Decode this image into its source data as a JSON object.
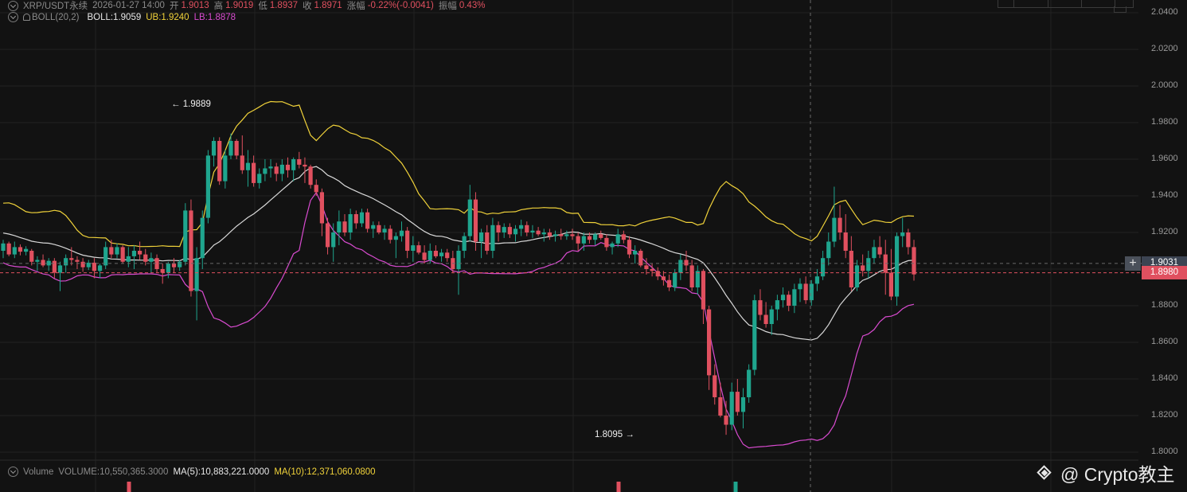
{
  "header": {
    "symbol": "XRP/USDT永续",
    "datetime": "2026-01-27 14:00",
    "open_label": "开",
    "open": "1.9013",
    "high_label": "高",
    "high": "1.9019",
    "low_label": "低",
    "low": "1.8937",
    "close_label": "收",
    "close": "1.8971",
    "change_label": "涨幅",
    "change": "-0.22%(-0.0041)",
    "amp_label": "振幅",
    "amp": "0.43%"
  },
  "boll": {
    "name": "BOLL(20,2)",
    "mid": "BOLL:1.9059",
    "ub": "UB:1.9240",
    "lb": "LB:1.8878"
  },
  "volume": {
    "name": "Volume",
    "value": "VOLUME:10,550,365.3000",
    "ma5": "MA(5):10,883,221.0000",
    "ma10": "MA(10):12,371,060.0800"
  },
  "price_boxes": {
    "crosshair": "1.9031",
    "last": "1.8980"
  },
  "annotations": {
    "high": "← 1.9889",
    "low": "1.8095 →"
  },
  "watermark": "@ Crypto教主",
  "colors": {
    "up": "#1fa58e",
    "down": "#e0505f",
    "ub": "#f0d23a",
    "mid": "#d8d8d8",
    "lb": "#d94bd0",
    "background": "#121212",
    "grid": "#222222"
  },
  "chart_data": {
    "type": "candlestick",
    "y_axis": {
      "ticks": [
        "2.0400",
        "2.0200",
        "2.0000",
        "1.9800",
        "1.9600",
        "1.9400",
        "1.9200",
        "1.9000",
        "1.8800",
        "1.8600",
        "1.8400",
        "1.8200",
        "1.8000"
      ],
      "range": [
        1.7925,
        2.042
      ]
    },
    "bars_total": 161,
    "candles": [
      [
        1.91,
        1.916,
        1.906,
        1.914
      ],
      [
        1.914,
        1.915,
        1.907,
        1.908
      ],
      [
        1.908,
        1.915,
        1.906,
        1.912
      ],
      [
        1.912,
        1.9135,
        1.9075,
        1.9095
      ],
      [
        1.9095,
        1.9125,
        1.9075,
        1.911
      ],
      [
        1.91,
        1.911,
        1.902,
        1.904
      ],
      [
        1.904,
        1.907,
        1.899,
        1.905
      ],
      [
        1.905,
        1.908,
        1.901,
        1.902
      ],
      [
        1.902,
        1.906,
        1.899,
        1.9045
      ],
      [
        1.9045,
        1.906,
        1.895,
        1.898
      ],
      [
        1.898,
        1.904,
        1.888,
        1.902
      ],
      [
        1.902,
        1.908,
        1.898,
        1.906
      ],
      [
        1.906,
        1.912,
        1.902,
        1.905
      ],
      [
        1.905,
        1.907,
        1.9,
        1.904
      ],
      [
        1.904,
        1.906,
        1.8985,
        1.901
      ],
      [
        1.901,
        1.905,
        1.8995,
        1.9035
      ],
      [
        1.9035,
        1.906,
        1.895,
        1.899
      ],
      [
        1.899,
        1.903,
        1.895,
        1.902
      ],
      [
        1.902,
        1.915,
        1.9,
        1.912
      ],
      [
        1.912,
        1.916,
        1.906,
        1.908
      ],
      [
        1.908,
        1.914,
        1.906,
        1.912
      ],
      [
        1.912,
        1.913,
        1.903,
        1.904
      ],
      [
        1.904,
        1.912,
        1.901,
        1.907
      ],
      [
        1.907,
        1.913,
        1.9,
        1.91
      ],
      [
        1.91,
        1.915,
        1.905,
        1.908
      ],
      [
        1.908,
        1.911,
        1.902,
        1.904
      ],
      [
        1.904,
        1.909,
        1.898,
        1.906
      ],
      [
        1.906,
        1.908,
        1.898,
        1.9
      ],
      [
        1.9,
        1.903,
        1.892,
        1.898
      ],
      [
        1.898,
        1.904,
        1.895,
        1.903
      ],
      [
        1.903,
        1.906,
        1.898,
        1.901
      ],
      [
        1.901,
        1.905,
        1.899,
        1.904
      ],
      [
        1.904,
        1.936,
        1.902,
        1.932
      ],
      [
        1.932,
        1.938,
        1.885,
        1.888
      ],
      [
        1.888,
        1.912,
        1.872,
        1.906
      ],
      [
        1.906,
        1.932,
        1.9,
        1.928
      ],
      [
        1.928,
        1.965,
        1.925,
        1.962
      ],
      [
        1.962,
        1.972,
        1.956,
        1.97
      ],
      [
        1.97,
        1.972,
        1.946,
        1.948
      ],
      [
        1.948,
        1.965,
        1.944,
        1.962
      ],
      [
        1.962,
        1.974,
        1.96,
        1.97
      ],
      [
        1.97,
        1.971,
        1.96,
        1.962
      ],
      [
        1.962,
        1.973,
        1.952,
        1.954
      ],
      [
        1.954,
        1.965,
        1.945,
        1.958
      ],
      [
        1.958,
        1.962,
        1.945,
        1.947
      ],
      [
        1.947,
        1.955,
        1.944,
        1.952
      ],
      [
        1.952,
        1.96,
        1.948,
        1.955
      ],
      [
        1.955,
        1.96,
        1.95,
        1.956
      ],
      [
        1.956,
        1.958,
        1.948,
        1.952
      ],
      [
        1.952,
        1.96,
        1.948,
        1.957
      ],
      [
        1.957,
        1.961,
        1.95,
        1.954
      ],
      [
        1.954,
        1.961,
        1.948,
        1.96
      ],
      [
        1.96,
        1.964,
        1.955,
        1.957
      ],
      [
        1.957,
        1.961,
        1.947,
        1.956
      ],
      [
        1.956,
        1.957,
        1.944,
        1.946
      ],
      [
        1.946,
        1.949,
        1.94,
        1.942
      ],
      [
        1.942,
        1.944,
        1.918,
        1.925
      ],
      [
        1.925,
        1.928,
        1.908,
        1.912
      ],
      [
        1.912,
        1.925,
        1.904,
        1.92
      ],
      [
        1.92,
        1.932,
        1.913,
        1.926
      ],
      [
        1.926,
        1.93,
        1.918,
        1.92
      ],
      [
        1.92,
        1.933,
        1.916,
        1.93
      ],
      [
        1.93,
        1.932,
        1.922,
        1.925
      ],
      [
        1.925,
        1.933,
        1.923,
        1.931
      ],
      [
        1.931,
        1.933,
        1.92,
        1.922
      ],
      [
        1.922,
        1.926,
        1.917,
        1.924
      ],
      [
        1.924,
        1.926,
        1.919,
        1.92
      ],
      [
        1.92,
        1.924,
        1.916,
        1.922
      ],
      [
        1.922,
        1.924,
        1.914,
        1.916
      ],
      [
        1.916,
        1.92,
        1.906,
        1.918
      ],
      [
        1.918,
        1.926,
        1.915,
        1.921
      ],
      [
        1.921,
        1.923,
        1.906,
        1.91
      ],
      [
        1.91,
        1.918,
        1.904,
        1.913
      ],
      [
        1.913,
        1.915,
        1.908,
        1.909
      ],
      [
        1.909,
        1.913,
        1.903,
        1.905
      ],
      [
        1.905,
        1.914,
        1.903,
        1.91
      ],
      [
        1.91,
        1.913,
        1.906,
        1.907
      ],
      [
        1.907,
        1.911,
        1.904,
        1.909
      ],
      [
        1.909,
        1.911,
        1.904,
        1.906
      ],
      [
        1.906,
        1.91,
        1.898,
        1.9
      ],
      [
        1.9,
        1.913,
        1.886,
        1.91
      ],
      [
        1.91,
        1.92,
        1.906,
        1.918
      ],
      [
        1.918,
        1.946,
        1.915,
        1.938
      ],
      [
        1.938,
        1.942,
        1.91,
        1.915
      ],
      [
        1.915,
        1.922,
        1.906,
        1.92
      ],
      [
        1.92,
        1.924,
        1.908,
        1.91
      ],
      [
        1.91,
        1.928,
        1.906,
        1.924
      ],
      [
        1.924,
        1.926,
        1.915,
        1.92
      ],
      [
        1.92,
        1.925,
        1.917,
        1.923
      ],
      [
        1.923,
        1.925,
        1.917,
        1.919
      ],
      [
        1.919,
        1.924,
        1.915,
        1.922
      ],
      [
        1.922,
        1.927,
        1.918,
        1.924
      ],
      [
        1.924,
        1.926,
        1.918,
        1.92
      ],
      [
        1.92,
        1.924,
        1.917,
        1.921
      ],
      [
        1.921,
        1.923,
        1.918,
        1.919
      ],
      [
        1.919,
        1.922,
        1.915,
        1.92
      ],
      [
        1.92,
        1.922,
        1.916,
        1.918
      ],
      [
        1.918,
        1.921,
        1.915,
        1.919
      ],
      [
        1.919,
        1.922,
        1.916,
        1.918
      ],
      [
        1.918,
        1.921,
        1.916,
        1.919
      ],
      [
        1.919,
        1.922,
        1.916,
        1.918
      ],
      [
        1.918,
        1.92,
        1.91,
        1.914
      ],
      [
        1.914,
        1.92,
        1.91,
        1.918
      ],
      [
        1.918,
        1.92,
        1.914,
        1.916
      ],
      [
        1.916,
        1.92,
        1.913,
        1.919
      ],
      [
        1.919,
        1.921,
        1.916,
        1.917
      ],
      [
        1.917,
        1.919,
        1.91,
        1.912
      ],
      [
        1.912,
        1.915,
        1.908,
        1.914
      ],
      [
        1.914,
        1.922,
        1.912,
        1.919
      ],
      [
        1.919,
        1.921,
        1.914,
        1.916
      ],
      [
        1.916,
        1.918,
        1.906,
        1.908
      ],
      [
        1.908,
        1.913,
        1.903,
        1.91
      ],
      [
        1.91,
        1.911,
        1.901,
        1.902
      ],
      [
        1.902,
        1.906,
        1.897,
        1.9
      ],
      [
        1.9,
        1.903,
        1.896,
        1.899
      ],
      [
        1.899,
        1.901,
        1.894,
        1.896
      ],
      [
        1.896,
        1.899,
        1.891,
        1.894
      ],
      [
        1.894,
        1.897,
        1.888,
        1.89
      ],
      [
        1.89,
        1.9,
        1.888,
        1.898
      ],
      [
        1.898,
        1.908,
        1.894,
        1.905
      ],
      [
        1.905,
        1.91,
        1.899,
        1.902
      ],
      [
        1.902,
        1.905,
        1.888,
        1.89
      ],
      [
        1.89,
        1.902,
        1.886,
        1.899
      ],
      [
        1.899,
        1.9,
        1.87,
        1.878
      ],
      [
        1.878,
        1.88,
        1.834,
        1.842
      ],
      [
        1.842,
        1.848,
        1.826,
        1.83
      ],
      [
        1.83,
        1.838,
        1.819,
        1.82
      ],
      [
        1.82,
        1.828,
        1.8095,
        1.815
      ],
      [
        1.815,
        1.838,
        1.812,
        1.833
      ],
      [
        1.833,
        1.84,
        1.82,
        1.822
      ],
      [
        1.822,
        1.835,
        1.813,
        1.83
      ],
      [
        1.83,
        1.848,
        1.827,
        1.845
      ],
      [
        1.845,
        1.886,
        1.842,
        1.883
      ],
      [
        1.883,
        1.889,
        1.872,
        1.875
      ],
      [
        1.875,
        1.882,
        1.868,
        1.87
      ],
      [
        1.87,
        1.88,
        1.864,
        1.878
      ],
      [
        1.878,
        1.886,
        1.872,
        1.883
      ],
      [
        1.883,
        1.89,
        1.879,
        1.886
      ],
      [
        1.886,
        1.888,
        1.877,
        1.88
      ],
      [
        1.88,
        1.892,
        1.876,
        1.889
      ],
      [
        1.889,
        1.895,
        1.882,
        1.892
      ],
      [
        1.892,
        1.896,
        1.881,
        1.883
      ],
      [
        1.883,
        1.894,
        1.88,
        1.892
      ],
      [
        1.892,
        1.9,
        1.888,
        1.896
      ],
      [
        1.896,
        1.91,
        1.894,
        1.906
      ],
      [
        1.906,
        1.92,
        1.902,
        1.915
      ],
      [
        1.915,
        1.945,
        1.912,
        1.928
      ],
      [
        1.928,
        1.935,
        1.916,
        1.92
      ],
      [
        1.92,
        1.93,
        1.906,
        1.91
      ],
      [
        1.91,
        1.918,
        1.888,
        1.89
      ],
      [
        1.89,
        1.905,
        1.888,
        1.902
      ],
      [
        1.902,
        1.908,
        1.896,
        1.899
      ],
      [
        1.899,
        1.91,
        1.895,
        1.906
      ],
      [
        1.906,
        1.916,
        1.903,
        1.912
      ],
      [
        1.912,
        1.918,
        1.906,
        1.908
      ],
      [
        1.908,
        1.916,
        1.886,
        1.898
      ],
      [
        1.898,
        1.911,
        1.883,
        1.885
      ],
      [
        1.885,
        1.92,
        1.88,
        1.918
      ],
      [
        1.918,
        1.928,
        1.912,
        1.92
      ],
      [
        1.92,
        1.922,
        1.908,
        1.912
      ],
      [
        1.912,
        1.916,
        1.8937,
        1.8971
      ]
    ],
    "ma_lines": [
      {
        "name": "UB",
        "y_range": [
          1.8878,
          2.0
        ]
      },
      {
        "name": "BOLL",
        "y_range": [
          1.86,
          1.975
        ]
      },
      {
        "name": "LB",
        "y_range": [
          1.806,
          1.912
        ]
      }
    ],
    "annotations": {
      "high": 1.9889,
      "low": 1.8095
    },
    "crosshair_price": 1.9031,
    "last_price": 1.898
  }
}
